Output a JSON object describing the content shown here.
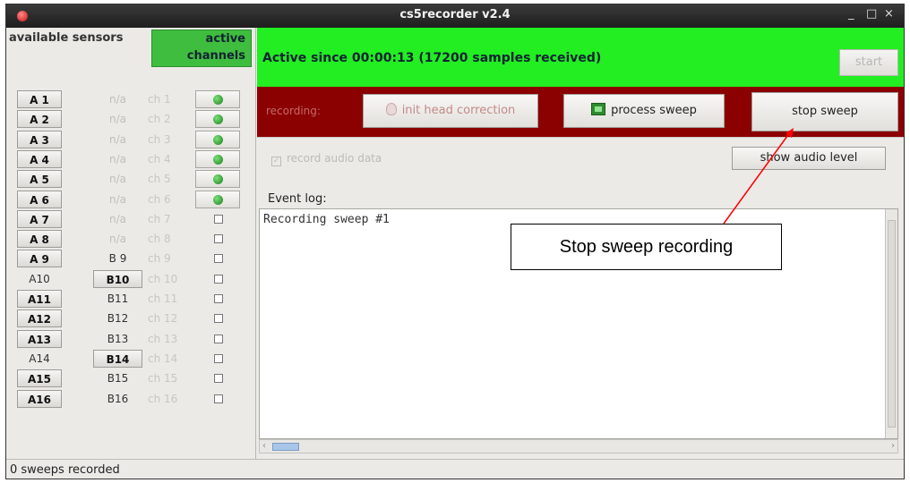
{
  "window": {
    "title": "cs5recorder v2.4",
    "min_glyph": "_",
    "max_glyph": "□",
    "close_glyph": "×"
  },
  "left_panel": {
    "available_header": "available sensors",
    "active_header": "active channels",
    "rows": [
      {
        "a": "A 1",
        "b": "n/a",
        "ch": "ch 1",
        "led": true,
        "a_btn": true,
        "b_btn": false,
        "b_faint": true
      },
      {
        "a": "A 2",
        "b": "n/a",
        "ch": "ch 2",
        "led": true,
        "a_btn": true,
        "b_btn": false,
        "b_faint": true
      },
      {
        "a": "A 3",
        "b": "n/a",
        "ch": "ch 3",
        "led": true,
        "a_btn": true,
        "b_btn": false,
        "b_faint": true
      },
      {
        "a": "A 4",
        "b": "n/a",
        "ch": "ch 4",
        "led": true,
        "a_btn": true,
        "b_btn": false,
        "b_faint": true
      },
      {
        "a": "A 5",
        "b": "n/a",
        "ch": "ch 5",
        "led": true,
        "a_btn": true,
        "b_btn": false,
        "b_faint": true
      },
      {
        "a": "A 6",
        "b": "n/a",
        "ch": "ch 6",
        "led": true,
        "a_btn": true,
        "b_btn": false,
        "b_faint": true
      },
      {
        "a": "A 7",
        "b": "n/a",
        "ch": "ch 7",
        "led": false,
        "a_btn": true,
        "b_btn": false,
        "b_faint": true
      },
      {
        "a": "A 8",
        "b": "n/a",
        "ch": "ch 8",
        "led": false,
        "a_btn": true,
        "b_btn": false,
        "b_faint": true
      },
      {
        "a": "A 9",
        "b": "B 9",
        "ch": "ch 9",
        "led": false,
        "a_btn": true,
        "b_btn": false,
        "b_faint": false
      },
      {
        "a": "A10",
        "b": "B10",
        "ch": "ch 10",
        "led": false,
        "a_btn": false,
        "b_btn": true,
        "b_faint": false
      },
      {
        "a": "A11",
        "b": "B11",
        "ch": "ch 11",
        "led": false,
        "a_btn": true,
        "b_btn": false,
        "b_faint": false
      },
      {
        "a": "A12",
        "b": "B12",
        "ch": "ch 12",
        "led": false,
        "a_btn": true,
        "b_btn": false,
        "b_faint": false
      },
      {
        "a": "A13",
        "b": "B13",
        "ch": "ch 13",
        "led": false,
        "a_btn": true,
        "b_btn": false,
        "b_faint": false
      },
      {
        "a": "A14",
        "b": "B14",
        "ch": "ch 14",
        "led": false,
        "a_btn": false,
        "b_btn": true,
        "b_faint": false
      },
      {
        "a": "A15",
        "b": "B15",
        "ch": "ch 15",
        "led": false,
        "a_btn": true,
        "b_btn": false,
        "b_faint": false
      },
      {
        "a": "A16",
        "b": "B16",
        "ch": "ch 16",
        "led": false,
        "a_btn": true,
        "b_btn": false,
        "b_faint": false
      }
    ]
  },
  "status_banner": {
    "text": "Active since 00:00:13 (17200 samples received)",
    "start_label": "start",
    "color": "#22ee22"
  },
  "recording_bar": {
    "label": "recording:",
    "init_head_label": "init head correction",
    "process_sweep_label": "process sweep",
    "stop_sweep_label": "stop sweep",
    "color": "#8b0000"
  },
  "audio": {
    "record_audio_label": "record audio data",
    "show_level_label": "show audio level"
  },
  "event_log": {
    "label": "Event log:",
    "text": "Recording sweep #1"
  },
  "statusbar": {
    "text": "0 sweeps recorded"
  },
  "annotation": {
    "callout_text": "Stop sweep recording",
    "arrow_color": "#ff0000"
  }
}
